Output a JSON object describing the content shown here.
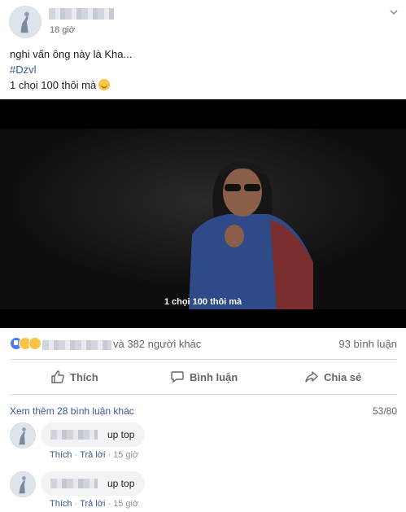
{
  "post": {
    "time": "18 giờ",
    "text_line1": "nghi vấn ông này là Kha...",
    "hashtag": "#Dzvl",
    "text_line3": "1 chọi 100 thôi mà",
    "emoji": "slightly-smiling-face-icon"
  },
  "video": {
    "subtitle": "1 chọi 100 thôi mà"
  },
  "reactions": {
    "icons": [
      "like-icon",
      "haha-icon",
      "sad-icon"
    ],
    "others_text": "và 382 người khác",
    "comments_text": "93 bình luận"
  },
  "actions": {
    "like_label": "Thích",
    "comment_label": "Bình luận",
    "share_label": "Chia sẻ"
  },
  "comments_section": {
    "more_label": "Xem thêm 28 bình luận khác",
    "page_count": "53/80",
    "items": [
      {
        "text": "up top",
        "like_label": "Thích",
        "reply_label": "Trả lời",
        "time": "15 giờ"
      },
      {
        "text": "up top",
        "like_label": "Thích",
        "reply_label": "Trả lời",
        "time": "15 giờ"
      }
    ]
  },
  "colors": {
    "link": "#385898",
    "secondary_text": "#606770",
    "like_blue": "#4b7bec",
    "emoji_yellow": "#f7c443"
  }
}
